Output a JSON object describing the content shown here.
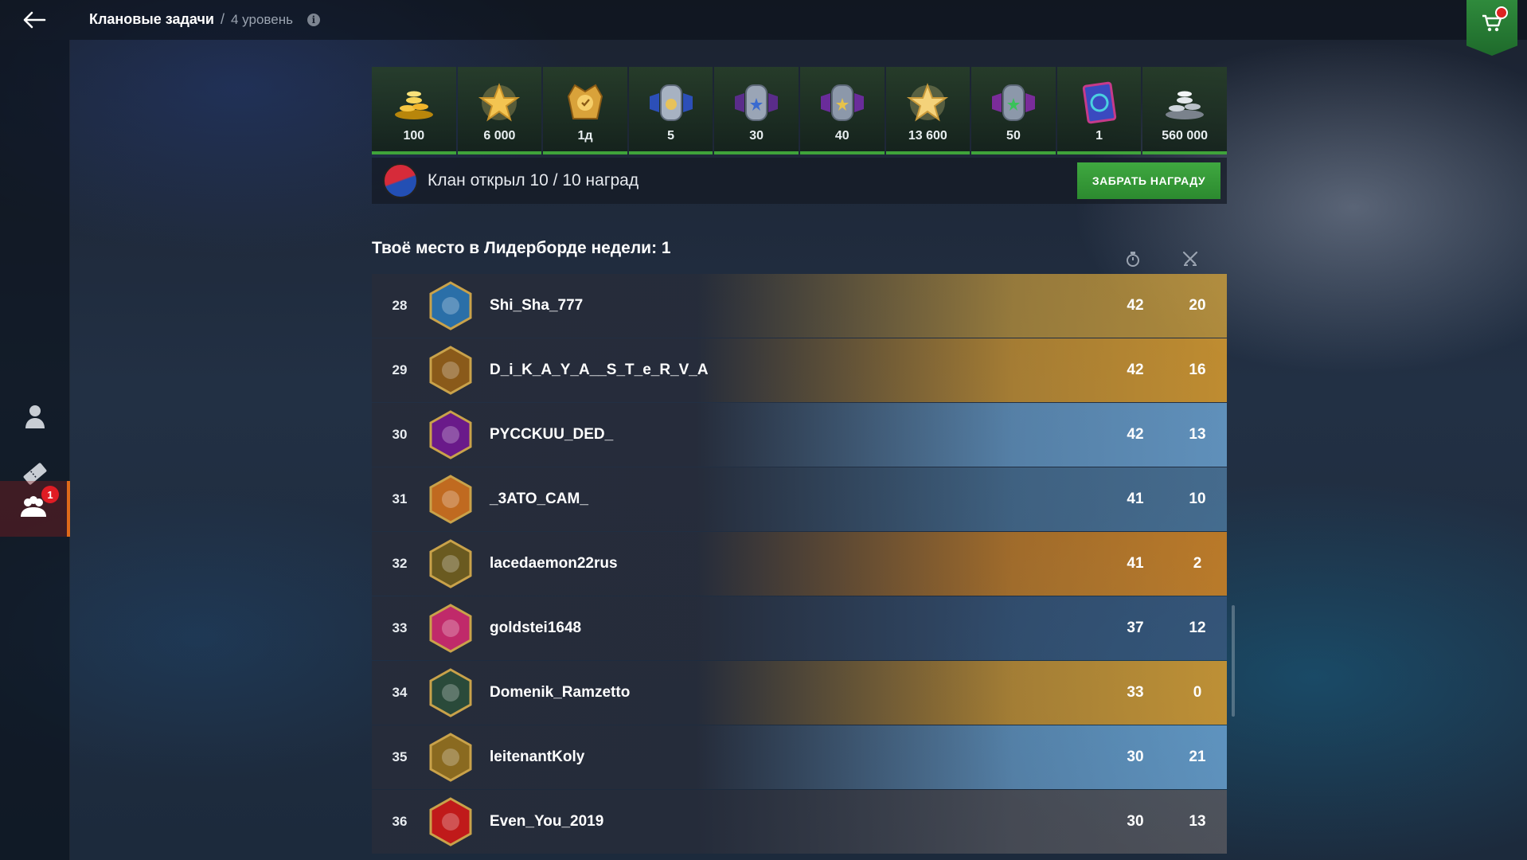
{
  "header": {
    "title": "Клановые задачи",
    "separator": "/",
    "level": "4 уровень"
  },
  "rewards": [
    {
      "icon": "gold-coins-icon",
      "value": "100"
    },
    {
      "icon": "star-xp-icon",
      "value": "6 000"
    },
    {
      "icon": "premium-account-icon",
      "value": "1д"
    },
    {
      "icon": "blue-crew-badge-icon",
      "value": "5"
    },
    {
      "icon": "silver-crew-badge-icon",
      "value": "30"
    },
    {
      "icon": "purple-crew-badge-icon",
      "value": "40"
    },
    {
      "icon": "free-xp-star-icon",
      "value": "13 600"
    },
    {
      "icon": "green-crew-badge-icon",
      "value": "50"
    },
    {
      "icon": "camo-card-icon",
      "value": "1"
    },
    {
      "icon": "silver-credits-icon",
      "value": "560 000"
    }
  ],
  "clan_status": {
    "text": "Клан открыл 10 / 10 наград",
    "claim_label": "ЗАБРАТЬ НАГРАДУ"
  },
  "leaderboard": {
    "title": "Твоё место в Лидерборде недели: 1",
    "rows": [
      {
        "rank": "28",
        "name": "Shi_Sha_777",
        "stat1": "42",
        "stat2": "20",
        "emblem": "#2a6fa8",
        "accent": "#d0a03a"
      },
      {
        "rank": "29",
        "name": "D_i_K_A_Y_A__S_T_e_R_V_A",
        "stat1": "42",
        "stat2": "16",
        "emblem": "#8a5a1a",
        "accent": "#e6a32c"
      },
      {
        "rank": "30",
        "name": "PYCCKUU_DED_",
        "stat1": "42",
        "stat2": "13",
        "emblem": "#6a1a8a",
        "accent": "#6fa8d8"
      },
      {
        "rank": "31",
        "name": "_3ATO_CAM_",
        "stat1": "41",
        "stat2": "10",
        "emblem": "#c06a20",
        "accent": "#4e7aa0"
      },
      {
        "rank": "32",
        "name": "lacedaemon22rus",
        "stat1": "41",
        "stat2": "2",
        "emblem": "#6a5a20",
        "accent": "#e08a20"
      },
      {
        "rank": "33",
        "name": "goldstei1648",
        "stat1": "37",
        "stat2": "12",
        "emblem": "#c02a6a",
        "accent": "#3a5a80"
      },
      {
        "rank": "34",
        "name": "Domenik_Ramzetto",
        "stat1": "33",
        "stat2": "0",
        "emblem": "#2a4a3a",
        "accent": "#e6a32c"
      },
      {
        "rank": "35",
        "name": "leitenantKoly",
        "stat1": "30",
        "stat2": "21",
        "emblem": "#8a6a20",
        "accent": "#6fa8d8"
      },
      {
        "rank": "36",
        "name": "Even_You_2019",
        "stat1": "30",
        "stat2": "13",
        "emblem": "#c01a1a",
        "accent": "#5a5a60"
      }
    ]
  },
  "sidebar": {
    "items": [
      {
        "icon": "profile-icon"
      },
      {
        "icon": "ticket-icon"
      },
      {
        "icon": "clan-tasks-icon",
        "badge": "1"
      }
    ]
  }
}
